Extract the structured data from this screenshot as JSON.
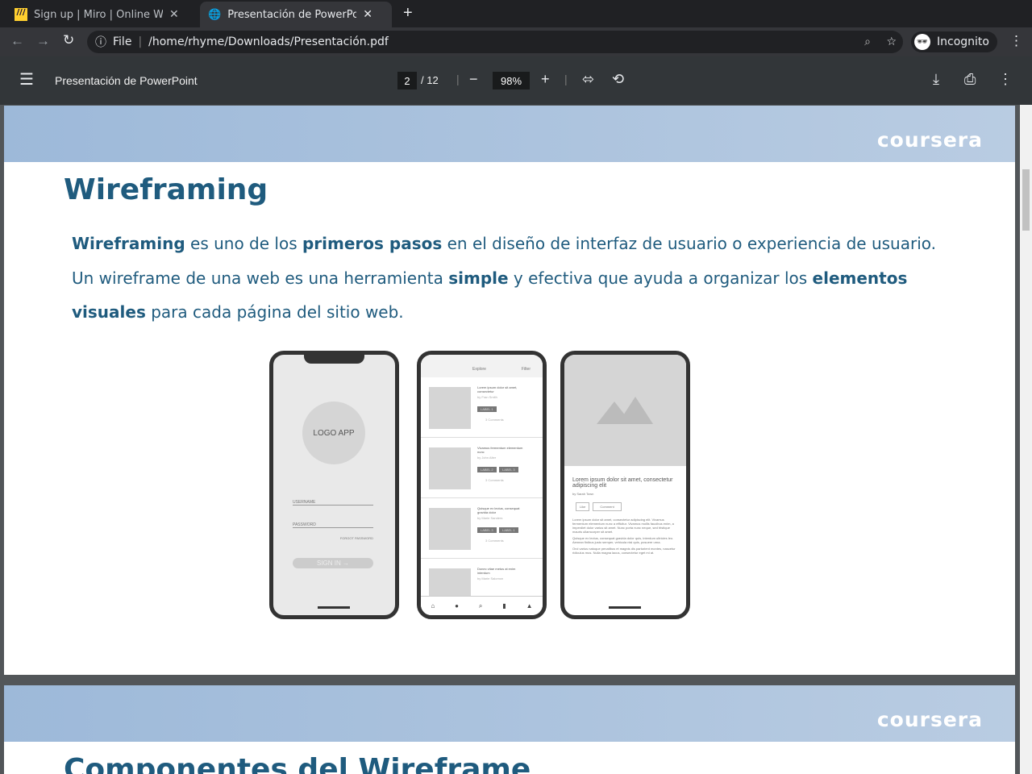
{
  "tabs": [
    {
      "title": "Sign up | Miro | Online Whit",
      "active": false
    },
    {
      "title": "Presentación de PowerPoint",
      "active": true
    }
  ],
  "address": {
    "scheme": "File",
    "url": "/home/rhyme/Downloads/Presentación.pdf",
    "incognito": "Incognito"
  },
  "pdf": {
    "title": "Presentación de PowerPoint",
    "page": "2",
    "total": "/ 12",
    "zoom": "98%"
  },
  "slide": {
    "brand": "coursera",
    "title": "Wireframing",
    "p": [
      "Wireframing",
      " es uno de los ",
      "primeros pasos",
      " en el diseño de interfaz de usuario o experiencia de usuario. Un wireframe de una web es una herramienta ",
      "simple",
      " y efectiva que ayuda a organizar los ",
      "elementos visuales",
      " para cada página del sitio web."
    ]
  },
  "phone1": {
    "logo": "LOGO APP",
    "username": "USERNAME",
    "password": "PASSWORD",
    "forgot": "FORGOT PASSWORD",
    "signin": "SIGN IN →"
  },
  "phone2": {
    "explore": "Explore",
    "filter": "Filter",
    "items": [
      {
        "title": "Lorem ipsum dolor sit amet, consectetur",
        "by": "by Fran Smith",
        "labels": [
          "LABEL 1"
        ],
        "comments": "3 Comments"
      },
      {
        "title": "Vivamus fermentum elementum nunc",
        "by": "by John Alter",
        "labels": [
          "LABEL 2",
          "LABEL 3"
        ],
        "comments": "3 Comments"
      },
      {
        "title": "Quisque ex lectus, consequat gravida dolor",
        "by": "by Marie Sanders",
        "labels": [
          "LABEL 3",
          "LABEL 1"
        ],
        "comments": "3 Comments"
      },
      {
        "title": "Donec vitae metus at enim interdum",
        "by": "by Marie Salomon"
      }
    ]
  },
  "phone3": {
    "title": "Lorem ipsum dolor sit amet, consectetur adipiscing elit",
    "by": "by Sarah Town",
    "like": "Like",
    "comment": "Comment",
    "body": [
      "Lorem ipsum dolor sit amet, consectetur adipiscing elit. Vivamus fermentum elementum nunc a efficitur. Vivamus mollis faucibus enim, a imperdiet dolor varius sit amet. Nunc porta nunc neque, sed tristique mauris ullamcorper sit amet.",
      "Quisque ex lectus, consequat gravida dolor quis, interdum ultricies leo. Aenean finibus justo semper, vehicula nisi quis, posuere urna.",
      "Orci varius natoque penatibus et magnis dis parturient montes, nascetur ridiculus mus. Nulla magna lacus, consectetur eget mi at."
    ]
  },
  "slide2": {
    "brand": "coursera",
    "title": "Componentes del Wireframe"
  }
}
